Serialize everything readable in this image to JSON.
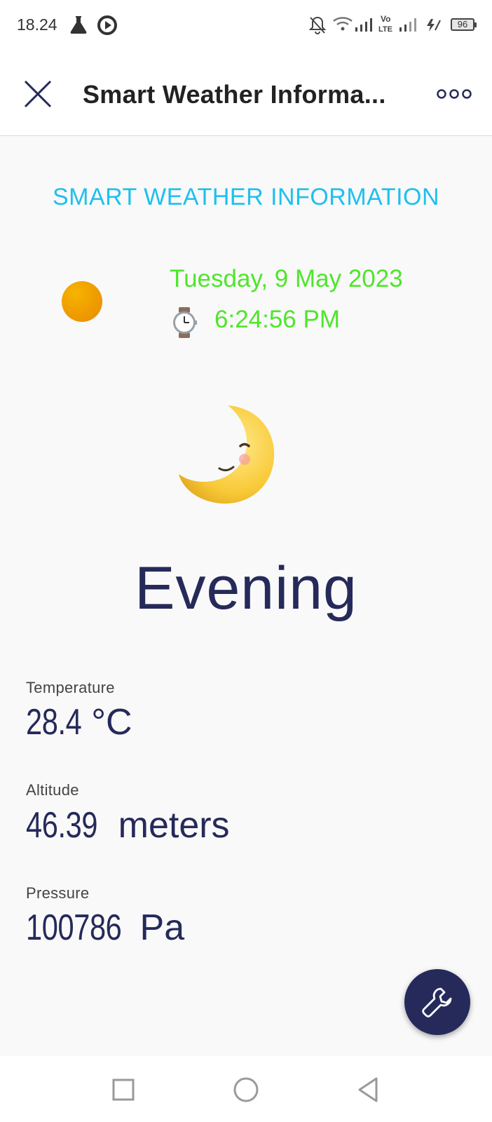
{
  "status_bar": {
    "time": "18.24",
    "battery_level": "96",
    "icons": [
      "flask-icon",
      "play-circle-icon",
      "bell-off-icon",
      "wifi-icon",
      "signal-icon",
      "volte-icon",
      "signal-icon",
      "charging-icon",
      "battery-icon"
    ]
  },
  "app_bar": {
    "close_icon": "close-icon",
    "title": "Smart Weather Informa...",
    "more_icon": "more-dots-icon"
  },
  "main": {
    "heading": "SMART WEATHER INFORMATION",
    "status_dot_color": "#ef9b00",
    "date": "Tuesday, 9 May 2023",
    "watch_icon": "wristwatch-icon",
    "time": "6:24:56 PM",
    "period_icon": "crescent-moon-icon",
    "period": "Evening",
    "accent_color": "#1ec0ee",
    "datetime_color": "#4ee62a",
    "text_color": "#252a5a",
    "readings": [
      {
        "label": "Temperature",
        "value": "28.4",
        "unit": "°C"
      },
      {
        "label": "Altitude",
        "value": "46.39",
        "unit": "meters"
      },
      {
        "label": "Pressure",
        "value": "100786",
        "unit": "Pa"
      }
    ]
  },
  "fab": {
    "icon": "wrench-icon",
    "color": "#252a5a"
  },
  "nav_bar": {
    "buttons": [
      "recents-square-icon",
      "home-circle-icon",
      "back-triangle-icon"
    ]
  }
}
